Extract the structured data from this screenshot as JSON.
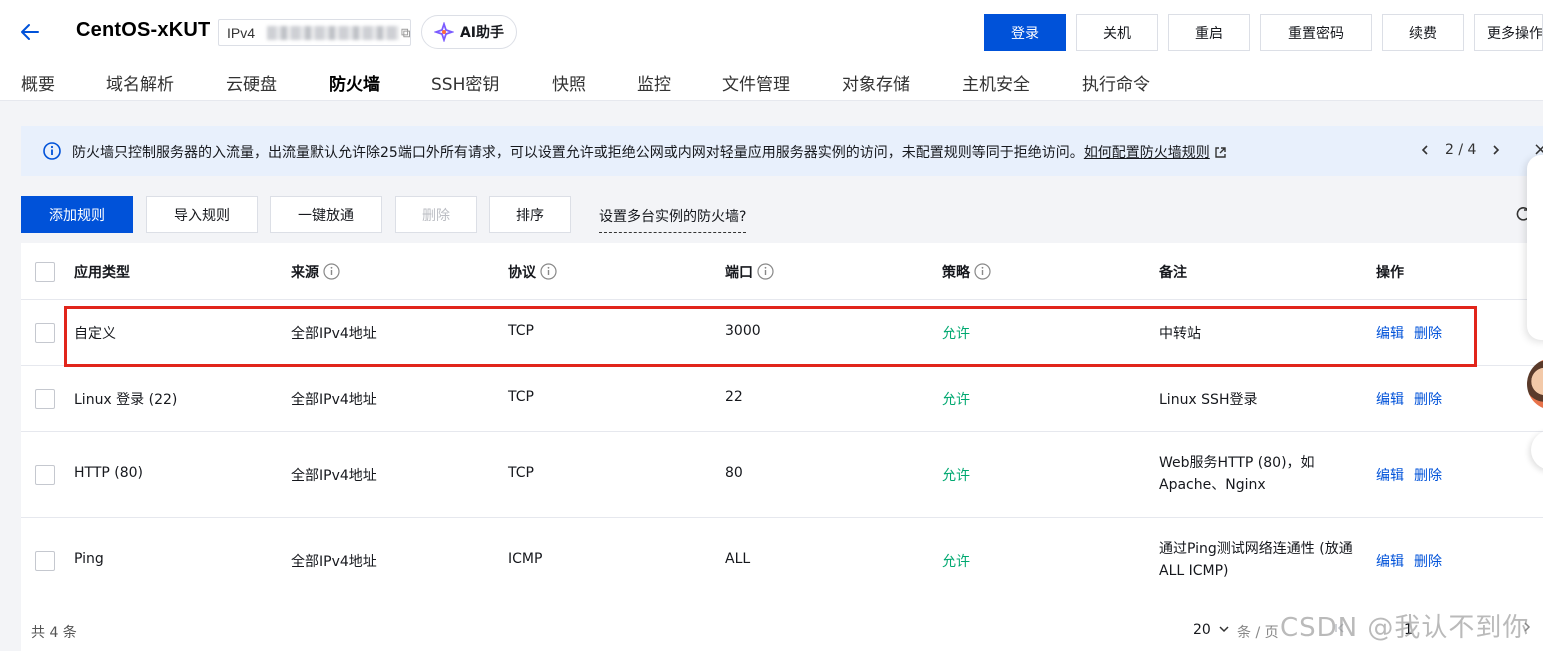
{
  "header": {
    "back_icon": "arrow-left-icon",
    "instance_name": "CentOS-xKUT",
    "ip_label": "IPv4",
    "ai_label": "AI助手",
    "buttons": {
      "login": "登录",
      "shutdown": "关机",
      "restart": "重启",
      "reset_password": "重置密码",
      "renew": "续费",
      "more": "更多操作"
    },
    "accent_color": "#0052d9"
  },
  "tabs": [
    {
      "label": "概要"
    },
    {
      "label": "域名解析"
    },
    {
      "label": "云硬盘"
    },
    {
      "label": "防火墙",
      "active": true
    },
    {
      "label": "SSH密钥"
    },
    {
      "label": "快照"
    },
    {
      "label": "监控"
    },
    {
      "label": "文件管理"
    },
    {
      "label": "对象存储"
    },
    {
      "label": "主机安全"
    },
    {
      "label": "执行命令"
    }
  ],
  "notice": {
    "text": "防火墙只控制服务器的入流量，出流量默认允许除25端口外所有请求，可以设置允许或拒绝公网或内网对轻量应用服务器实例的访问，未配置规则等同于拒绝访问。",
    "link": "如何配置防火墙规则",
    "pager": "2 / 4",
    "close": "×"
  },
  "toolbar": {
    "add_rule": "添加规则",
    "import_rule": "导入规则",
    "open_all": "一键放通",
    "delete": "删除",
    "sort": "排序",
    "multi_instance": "设置多台实例的防火墙?"
  },
  "table": {
    "headers": {
      "app_type": "应用类型",
      "source": "来源",
      "protocol": "协议",
      "port": "端口",
      "policy": "策略",
      "remark": "备注",
      "actions": "操作"
    },
    "rows": [
      {
        "app_type": "自定义",
        "source": "全部IPv4地址",
        "protocol": "TCP",
        "port": "3000",
        "policy": "允许",
        "remark": "中转站",
        "edit": "编辑",
        "delete": "删除"
      },
      {
        "app_type": "Linux 登录 (22)",
        "source": "全部IPv4地址",
        "protocol": "TCP",
        "port": "22",
        "policy": "允许",
        "remark": "Linux SSH登录",
        "edit": "编辑",
        "delete": "删除"
      },
      {
        "app_type": "HTTP (80)",
        "source": "全部IPv4地址",
        "protocol": "TCP",
        "port": "80",
        "policy": "允许",
        "remark": "Web服务HTTP (80)，如 Apache、Nginx",
        "edit": "编辑",
        "delete": "删除"
      },
      {
        "app_type": "Ping",
        "source": "全部IPv4地址",
        "protocol": "ICMP",
        "port": "ALL",
        "policy": "允许",
        "remark": "通过Ping测试网络连通性 (放通ALL ICMP)",
        "edit": "编辑",
        "delete": "删除"
      }
    ],
    "allow_color": "#00a870",
    "highlight_color": "#e1251b"
  },
  "footer": {
    "total": "共 4 条",
    "page_size": "20",
    "per_page": "条 / 页",
    "current_page": "1"
  },
  "watermark": "CSDN @我认不到你"
}
